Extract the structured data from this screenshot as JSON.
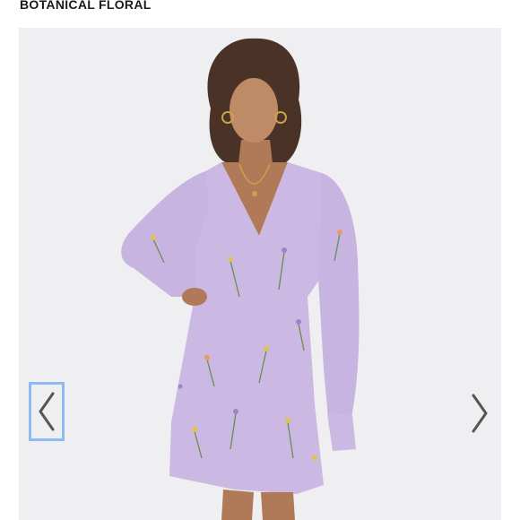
{
  "product": {
    "title": "BOTANICAL FLORAL"
  },
  "gallery": {
    "prev_icon": "chevron-left-icon",
    "next_icon": "chevron-right-icon",
    "prev_focus_color": "#8fb9f2",
    "chevron_color": "#555555",
    "dress_color": "#cbb9e3",
    "background_color": "#efeff1"
  }
}
